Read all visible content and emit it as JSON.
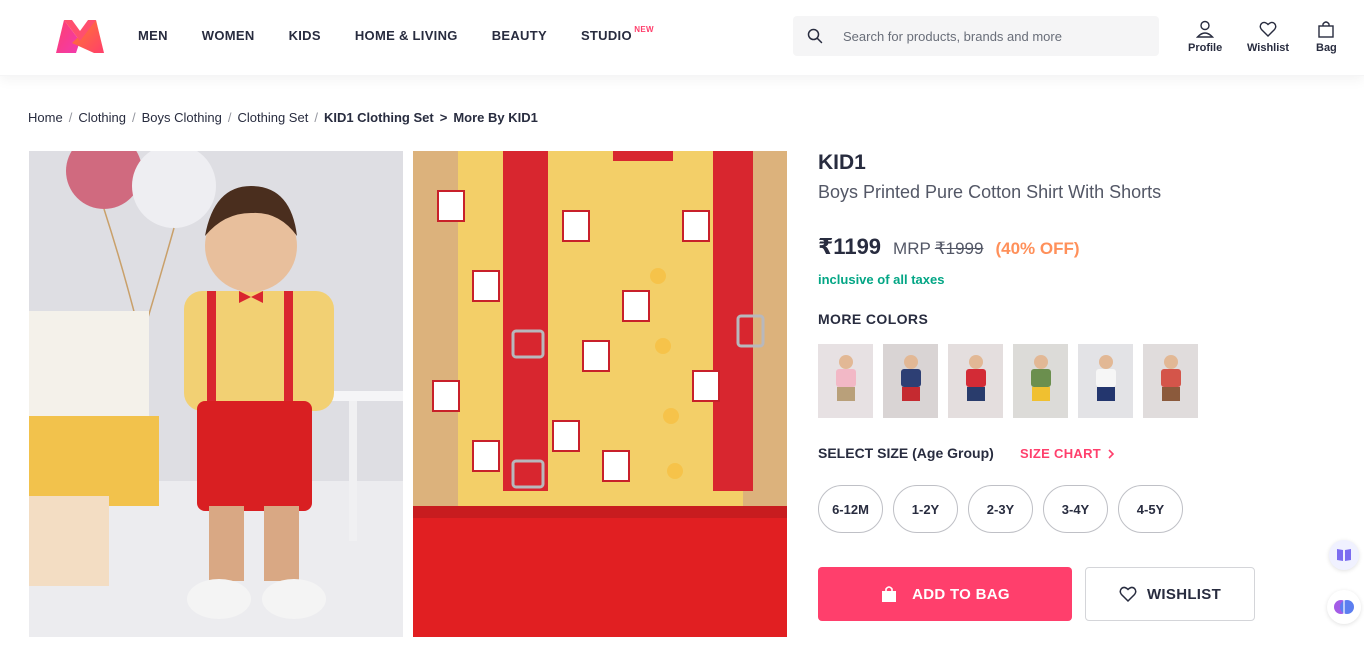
{
  "header": {
    "nav": [
      {
        "label": "MEN"
      },
      {
        "label": "WOMEN"
      },
      {
        "label": "KIDS"
      },
      {
        "label": "HOME & LIVING"
      },
      {
        "label": "BEAUTY"
      },
      {
        "label": "STUDIO",
        "badge": "NEW"
      }
    ],
    "search_placeholder": "Search for products, brands and more",
    "actions": {
      "profile": "Profile",
      "wishlist": "Wishlist",
      "bag": "Bag"
    },
    "logo_icon": "myntra-logo-icon"
  },
  "breadcrumb": [
    "Home",
    "Clothing",
    "Boys Clothing",
    "Clothing Set",
    "KID1 Clothing Set",
    "More By KID1"
  ],
  "breadcrumb_arrow": ">",
  "product": {
    "brand": "KID1",
    "name": "Boys Printed Pure Cotton Shirt With Shorts",
    "price": "₹1199",
    "mrp_label": "MRP",
    "mrp": "₹1999",
    "discount": "(40% OFF)",
    "taxes_note": "inclusive of all taxes",
    "more_colors_title": "MORE COLORS",
    "color_swatches": [
      "pink",
      "navy",
      "red",
      "yellow",
      "white",
      "brown"
    ],
    "size_title": "SELECT SIZE (Age Group)",
    "size_chart_label": "SIZE CHART",
    "sizes": [
      "6-12M",
      "1-2Y",
      "2-3Y",
      "3-4Y",
      "4-5Y"
    ],
    "add_to_bag_label": "ADD TO BAG",
    "wishlist_label": "WISHLIST"
  },
  "colors": {
    "accent": "#ff3f6c",
    "discount": "#ff905a",
    "taxes": "#03a685",
    "text": "#282c3f"
  }
}
